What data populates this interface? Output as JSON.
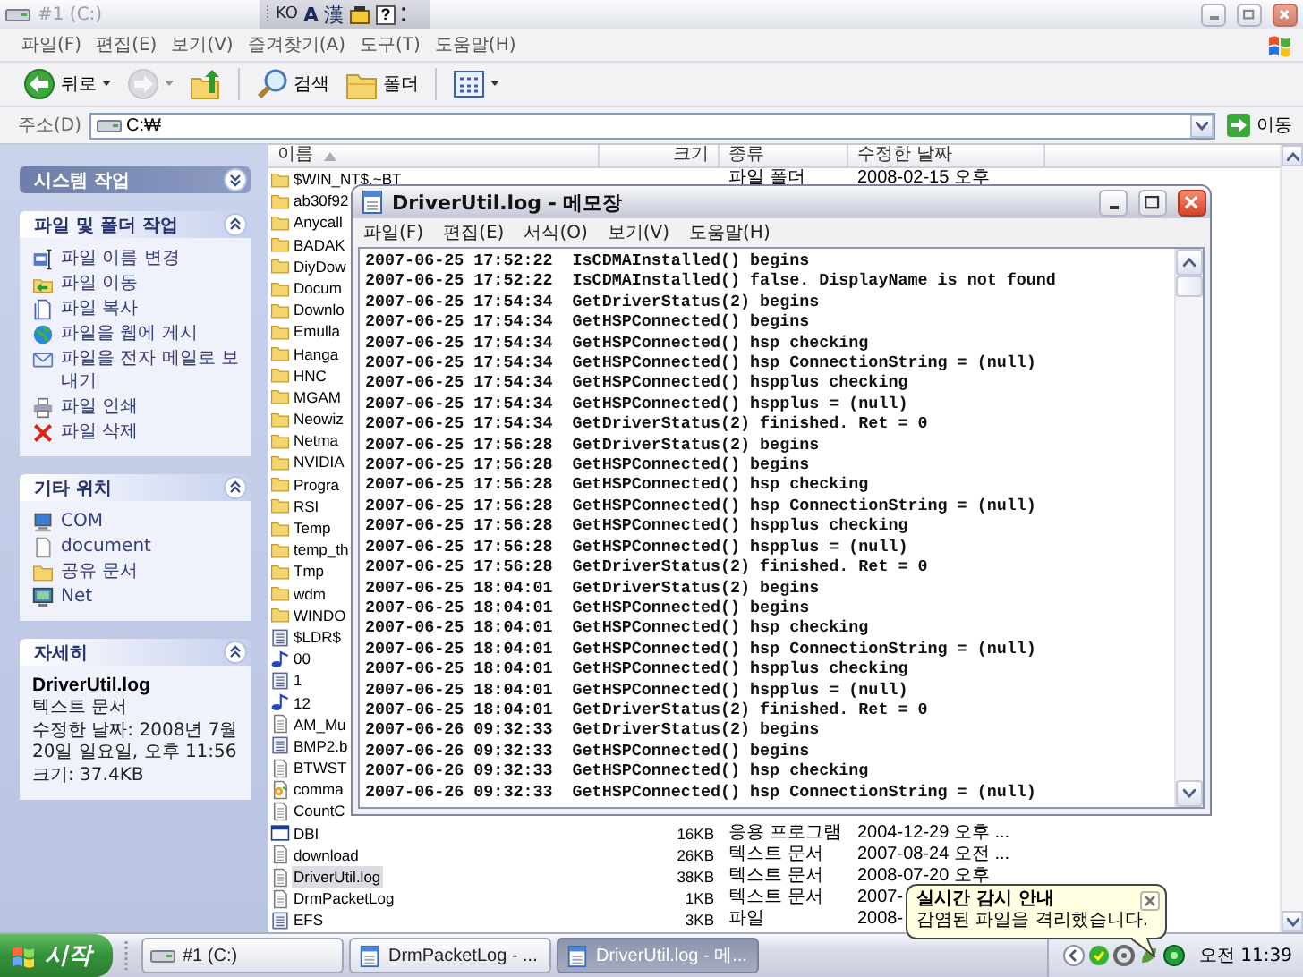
{
  "explorer": {
    "title": "#1 (C:)",
    "active": false,
    "menu": [
      "파일(F)",
      "편집(E)",
      "보기(V)",
      "즐겨찾기(A)",
      "도구(T)",
      "도움말(H)"
    ],
    "toolbar": [
      {
        "kind": "back",
        "label": "뒤로",
        "disabled": false
      },
      {
        "kind": "forward",
        "disabled": true
      },
      {
        "kind": "up",
        "disabled": false
      },
      {
        "kind": "search",
        "label": "검색",
        "disabled": false
      },
      {
        "kind": "folders",
        "label": "폴더",
        "disabled": false
      },
      {
        "kind": "views",
        "disabled": false
      }
    ],
    "address": {
      "label": "주소(D)",
      "value": "C:₩",
      "go": "이동"
    },
    "task_panel": [
      {
        "kind": "special",
        "title": "시스템 작업",
        "expanded": false
      },
      {
        "kind": "links",
        "title": "파일 및 폴더 작업",
        "expanded": true,
        "items": [
          {
            "kind": "rename",
            "label": "파일 이름 변경"
          },
          {
            "kind": "move",
            "label": "파일 이동"
          },
          {
            "kind": "copy",
            "label": "파일 복사"
          },
          {
            "kind": "publish",
            "label": "파일을 웹에 게시"
          },
          {
            "kind": "email",
            "label": "파일을 전자 메일로 보내기"
          },
          {
            "kind": "print",
            "label": "파일 인쇄"
          },
          {
            "kind": "delete",
            "label": "파일 삭제"
          }
        ]
      },
      {
        "kind": "links",
        "title": "기타 위치",
        "expanded": true,
        "items": [
          {
            "kind": "drive",
            "label": "COM"
          },
          {
            "kind": "document",
            "label": "document"
          },
          {
            "kind": "folder",
            "label": "공유 문서"
          },
          {
            "kind": "network",
            "label": "Net"
          }
        ]
      },
      {
        "kind": "details",
        "title": "자세히",
        "expanded": true,
        "name": "DriverUtil.log",
        "lines": [
          "텍스트 문서",
          "수정한 날짜: 2008년 7월 20일 일요일, 오후 11:56",
          "크기: 37.4KB"
        ]
      }
    ],
    "file_list": {
      "columns": [
        {
          "label": "이름",
          "sorted": true
        },
        {
          "label": "크기",
          "sorted": false
        },
        {
          "label": "종류",
          "sorted": false
        },
        {
          "label": "수정한 날짜",
          "sorted": false
        }
      ],
      "rows": [
        {
          "name": "$WIN_NT$.~BT",
          "kind": "folder",
          "type": "파일 폴더",
          "modified": "2008-02-15 오후",
          "selected": false
        },
        {
          "name": "ab30f92",
          "kind": "folder",
          "selected": false
        },
        {
          "name": "Anycall",
          "kind": "folder",
          "selected": false
        },
        {
          "name": "BADAK",
          "kind": "folder",
          "selected": false
        },
        {
          "name": "DiyDow",
          "kind": "folder",
          "selected": false
        },
        {
          "name": "Docum",
          "kind": "folder",
          "selected": false
        },
        {
          "name": "Downlo",
          "kind": "folder",
          "selected": false
        },
        {
          "name": "Emulla",
          "kind": "folder",
          "selected": false
        },
        {
          "name": "Hanga",
          "kind": "folder",
          "selected": false
        },
        {
          "name": "HNC",
          "kind": "folder",
          "selected": false
        },
        {
          "name": "MGAM",
          "kind": "folder",
          "selected": false
        },
        {
          "name": "Neowiz",
          "kind": "folder",
          "selected": false
        },
        {
          "name": "Netma",
          "kind": "folder",
          "selected": false
        },
        {
          "name": "NVIDIA",
          "kind": "folder",
          "selected": false
        },
        {
          "name": "Progra",
          "kind": "folder",
          "selected": false
        },
        {
          "name": "RSI",
          "kind": "folder",
          "selected": false
        },
        {
          "name": "Temp",
          "kind": "folder",
          "selected": false
        },
        {
          "name": "temp_th",
          "kind": "folder",
          "selected": false
        },
        {
          "name": "Tmp",
          "kind": "folder",
          "selected": false
        },
        {
          "name": "wdm",
          "kind": "folder",
          "selected": false
        },
        {
          "name": "WINDO",
          "kind": "folder",
          "selected": false
        },
        {
          "name": "$LDR$",
          "kind": "system",
          "selected": false
        },
        {
          "name": "00",
          "kind": "audio",
          "selected": false
        },
        {
          "name": "1",
          "kind": "system",
          "selected": false
        },
        {
          "name": "12",
          "kind": "audio",
          "selected": false
        },
        {
          "name": "AM_Mu",
          "kind": "text",
          "selected": false
        },
        {
          "name": "BMP2.b",
          "kind": "system",
          "selected": false
        },
        {
          "name": "BTWST",
          "kind": "text",
          "selected": false
        },
        {
          "name": "comma",
          "kind": "batch",
          "selected": false
        },
        {
          "name": "CountC",
          "kind": "text",
          "selected": false
        },
        {
          "name": "DBI",
          "kind": "app",
          "size": "16KB",
          "type": "응용 프로그램",
          "modified": "2004-12-29 오후 ...",
          "selected": false
        },
        {
          "name": "download",
          "kind": "text",
          "size": "26KB",
          "type": "텍스트 문서",
          "modified": "2007-08-24 오전 ...",
          "selected": false
        },
        {
          "name": "DriverUtil.log",
          "kind": "text",
          "size": "38KB",
          "type": "텍스트 문서",
          "modified": "2008-07-20 오후",
          "selected": true
        },
        {
          "name": "DrmPacketLog",
          "kind": "text",
          "size": "1KB",
          "type": "텍스트 문서",
          "modified": "2007-",
          "selected": false
        },
        {
          "name": "EFS",
          "kind": "system",
          "size": "3KB",
          "type": "파일",
          "modified": "2008-",
          "selected": false
        }
      ]
    }
  },
  "ime_bar": {
    "language": "KO",
    "mode": "A",
    "hanja": "漢",
    "help": "?"
  },
  "notepad": {
    "title": "DriverUtil.log - 메모장",
    "active": true,
    "menu": [
      "파일(F)",
      "편집(E)",
      "서식(O)",
      "보기(V)",
      "도움말(H)"
    ],
    "lines": [
      "2007-06-25 17:52:22  IsCDMAInstalled() begins",
      "2007-06-25 17:52:22  IsCDMAInstalled() false. DisplayName is not found",
      "2007-06-25 17:54:34  GetDriverStatus(2) begins",
      "2007-06-25 17:54:34  GetHSPConnected() begins",
      "2007-06-25 17:54:34  GetHSPConnected() hsp checking",
      "2007-06-25 17:54:34  GetHSPConnected() hsp ConnectionString = (null)",
      "2007-06-25 17:54:34  GetHSPConnected() hspplus checking",
      "2007-06-25 17:54:34  GetHSPConnected() hspplus = (null)",
      "2007-06-25 17:54:34  GetDriverStatus(2) finished. Ret = 0",
      "2007-06-25 17:56:28  GetDriverStatus(2) begins",
      "2007-06-25 17:56:28  GetHSPConnected() begins",
      "2007-06-25 17:56:28  GetHSPConnected() hsp checking",
      "2007-06-25 17:56:28  GetHSPConnected() hsp ConnectionString = (null)",
      "2007-06-25 17:56:28  GetHSPConnected() hspplus checking",
      "2007-06-25 17:56:28  GetHSPConnected() hspplus = (null)",
      "2007-06-25 17:56:28  GetDriverStatus(2) finished. Ret = 0",
      "2007-06-25 18:04:01  GetDriverStatus(2) begins",
      "2007-06-25 18:04:01  GetHSPConnected() begins",
      "2007-06-25 18:04:01  GetHSPConnected() hsp checking",
      "2007-06-25 18:04:01  GetHSPConnected() hsp ConnectionString = (null)",
      "2007-06-25 18:04:01  GetHSPConnected() hspplus checking",
      "2007-06-25 18:04:01  GetHSPConnected() hspplus = (null)",
      "2007-06-25 18:04:01  GetDriverStatus(2) finished. Ret = 0",
      "2007-06-26 09:32:33  GetDriverStatus(2) begins",
      "2007-06-26 09:32:33  GetHSPConnected() begins",
      "2007-06-26 09:32:33  GetHSPConnected() hsp checking",
      "2007-06-26 09:32:33  GetHSPConnected() hsp ConnectionString = (null)"
    ]
  },
  "balloon": {
    "title": "실시간 감시 안내",
    "text": "감염된 파일을 격리했습니다."
  },
  "taskbar": {
    "start": "시작",
    "tasks": [
      {
        "label": "#1 (C:)",
        "kind": "drive",
        "selected": false
      },
      {
        "label": "DrmPacketLog - ...",
        "kind": "notepad",
        "selected": false
      },
      {
        "label": "DriverUtil.log - 메...",
        "kind": "notepad",
        "selected": true
      }
    ],
    "clock": "오전 11:39"
  }
}
